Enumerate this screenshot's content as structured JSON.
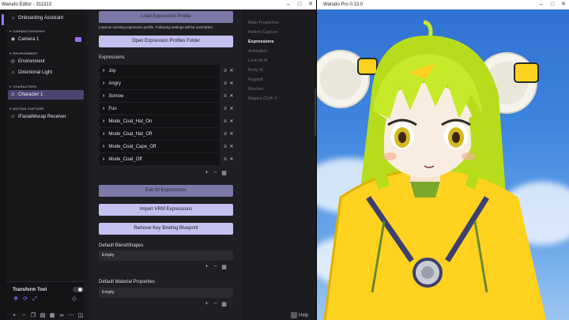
{
  "editor": {
    "title": "Warudo Editor - 311313",
    "window_controls": {
      "minimize": "–",
      "maximize": "□",
      "close": "✕"
    }
  },
  "sidebar": {
    "onboarding": {
      "label": "Onboarding Assistant",
      "icon": "home-icon"
    },
    "sections": [
      {
        "heading": "CINEMATOGRAPHY",
        "items": [
          {
            "label": "Camera 1",
            "icon": "camera-icon"
          }
        ]
      },
      {
        "heading": "ENVIRONMENT",
        "items": [
          {
            "label": "Environment",
            "icon": "globe-icon"
          },
          {
            "label": "Directional Light",
            "icon": "lightbulb-icon"
          }
        ]
      },
      {
        "heading": "CHARACTERS",
        "items": [
          {
            "label": "Character 1",
            "icon": "person-icon",
            "selected": true
          }
        ]
      },
      {
        "heading": "MOTION CAPTURE",
        "items": [
          {
            "label": "iFacialMocap Receiver",
            "icon": "face-icon"
          }
        ]
      }
    ],
    "tool_panel": {
      "title": "Transform Tool",
      "toggle_on": false
    },
    "bottom_icons": [
      "plus-icon",
      "minus-icon",
      "copy-icon",
      "clipboard-icon",
      "grid-icon",
      "link-icon",
      "more-icon",
      "panel-icon"
    ]
  },
  "inspector": {
    "load_profile_button": "Load Expression Profile",
    "load_hint": "Load an existing expression profile. Following settings will be overridden.",
    "open_folder_button": "Open Expression Profiles Folder",
    "expressions_label": "Expressions",
    "expressions": [
      "Joy",
      "Angry",
      "Sorrow",
      "Fun",
      "Mode_Coat_Hat_On",
      "Mode_Coat_Hat_Off",
      "Mode_Coat_Cape_Off",
      "Mode_Coat_Off"
    ],
    "exit_all_button": "Exit All Expressions",
    "import_vrm_button": "Import VRM Expressions",
    "remove_blueprint_button": "Remove Key Binding Blueprint",
    "default_blendshapes_label": "Default BlendShapes",
    "default_blendshapes_value": "Empty",
    "default_material_label": "Default Material Properties",
    "default_material_value": "Empty"
  },
  "tabs": {
    "items": [
      "Main Properties",
      "Motion Capture",
      "Expressions",
      "Animation",
      "Look At IK",
      "Body IK",
      "Ragdoll",
      "Meshes",
      "Magica Cloth 2"
    ],
    "active": "Expressions",
    "help_label": "Help"
  },
  "preview": {
    "title": "Warudo Pro 0.13.0",
    "sky_color": "#3e86e0",
    "hair_color": "#c6ea2a",
    "coat_color": "#ffd21f"
  }
}
